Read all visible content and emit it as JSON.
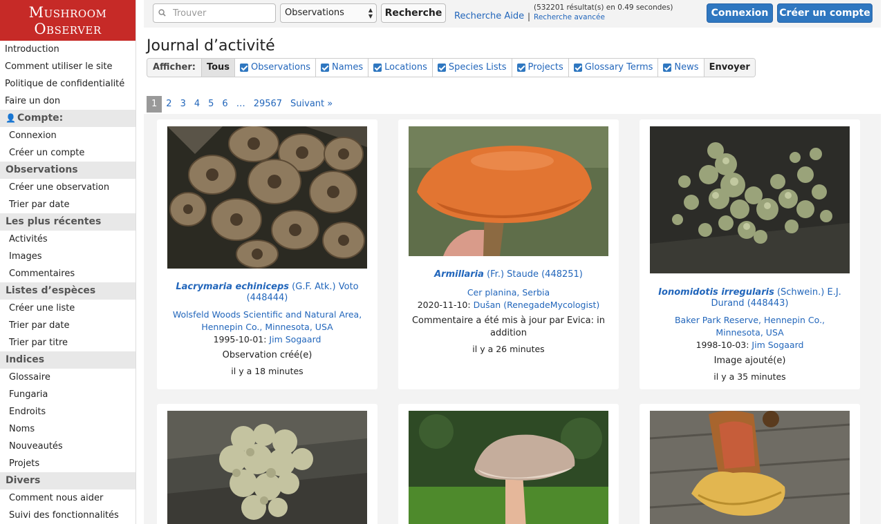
{
  "site": {
    "logo_line1": "Mushroom",
    "logo_line2": "Observer"
  },
  "sidebar": {
    "top_links": [
      "Introduction",
      "Comment utiliser le site",
      "Politique de confidentialité",
      "Faire un don"
    ],
    "account": {
      "heading": "Compte:",
      "items": [
        "Connexion",
        "Créer un compte"
      ]
    },
    "observations": {
      "heading": "Observations",
      "items": [
        "Créer une observation",
        "Trier par date"
      ]
    },
    "recent": {
      "heading": "Les plus récentes",
      "items": [
        "Activités",
        "Images",
        "Commentaires"
      ]
    },
    "species_lists": {
      "heading": "Listes d’espèces",
      "items": [
        "Créer une liste",
        "Trier par date",
        "Trier par titre"
      ]
    },
    "indices": {
      "heading": "Indices",
      "items": [
        "Glossaire",
        "Fungaria",
        "Endroits",
        "Noms",
        "Nouveautés",
        "Projets"
      ]
    },
    "misc": {
      "heading": "Divers",
      "items": [
        "Comment nous aider",
        "Suivi des fonctionnalités"
      ]
    }
  },
  "topbar": {
    "search_placeholder": "Trouver",
    "search_type": "Observations",
    "search_button": "Recherche",
    "help_link": "Recherche Aide",
    "separator": "|",
    "results_text": "(532201 résultat(s) en 0.49 secondes)",
    "advanced_link": "Recherche avancée",
    "login_button": "Connexion",
    "signup_button": "Créer un compte"
  },
  "main": {
    "title": "Journal d’activité",
    "filter": {
      "label": "Afficher:",
      "all": "Tous",
      "options": [
        "Observations",
        "Names",
        "Locations",
        "Species Lists",
        "Projects",
        "Glossary Terms",
        "News"
      ],
      "submit": "Envoyer"
    },
    "pagination": {
      "active": "1",
      "pages": [
        "2",
        "3",
        "4",
        "5",
        "6"
      ],
      "ellipsis": "…",
      "last": "29567",
      "next": "Suivant »"
    },
    "cards": [
      {
        "name": "Lacrymaria echiniceps",
        "author": "(G.F. Atk.) Voto",
        "id": "(448444)",
        "location": "Wolsfeld Woods Scientific and Natural Area, Hennepin Co., Minnesota, USA",
        "date": "1995-10-01:",
        "user": "Jim Sogaard",
        "action": "Observation créé(e)",
        "ago": "il y a 18 minutes"
      },
      {
        "name": "Armillaria",
        "author": "(Fr.) Staude",
        "id": "(448251)",
        "location": "Cer planina, Serbia",
        "date": "2020-11-10:",
        "user": "Dušan (RenegadeMycologist)",
        "action": "Commentaire a été mis à jour par Evica: in addition",
        "ago": "il y a 26 minutes"
      },
      {
        "name": "Ionomidotis irregularis",
        "author": "(Schwein.) E.J. Durand",
        "id": "(448443)",
        "location": "Baker Park Reserve, Hennepin Co., Minnesota, USA",
        "date": "1998-10-03:",
        "user": "Jim Sogaard",
        "action": "Image ajouté(e)",
        "ago": "il y a 35 minutes"
      }
    ]
  }
}
